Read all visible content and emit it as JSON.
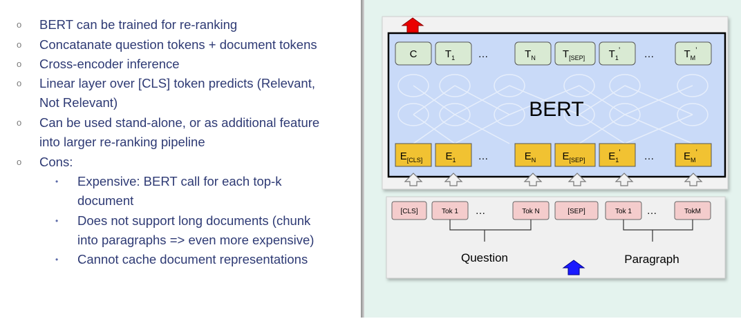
{
  "bullets": {
    "b1": "BERT can be trained for re-ranking",
    "b2": "Concatanate question tokens + document tokens",
    "b3": "Cross-encoder inference",
    "b4_line1": "Linear layer over [CLS] token predicts (Relevant,",
    "b4_line2": "Not Relevant)",
    "b5_line1": "Can be used stand-alone, or as additional feature",
    "b5_line2": "into larger re-ranking pipeline",
    "b6": "Cons:",
    "sub": {
      "s1_line1": "Expensive: BERT call for each top-k",
      "s1_line2": "document",
      "s2_line1": "Does not support long documents (chunk",
      "s2_line2": "into paragraphs => even more expensive)",
      "s3": "Cannot cache document representations"
    }
  },
  "markers": {
    "hollow": "o",
    "dot": "•"
  },
  "diagram": {
    "model_label": "BERT",
    "ellipsis": "…",
    "output_tokens": [
      {
        "base": "C",
        "sub": "",
        "sup": ""
      },
      {
        "base": "T",
        "sub": "1",
        "sup": ""
      },
      {
        "base": "T",
        "sub": "N",
        "sup": ""
      },
      {
        "base": "T",
        "sub": "[SEP]",
        "sup": ""
      },
      {
        "base": "T",
        "sub": "1",
        "sup": "’"
      },
      {
        "base": "T",
        "sub": "M",
        "sup": "’"
      }
    ],
    "embedding_tokens": [
      {
        "base": "E",
        "sub": "[CLS]",
        "sup": ""
      },
      {
        "base": "E",
        "sub": "1",
        "sup": ""
      },
      {
        "base": "E",
        "sub": "N",
        "sup": ""
      },
      {
        "base": "E",
        "sub": "[SEP]",
        "sup": ""
      },
      {
        "base": "E",
        "sub": "1",
        "sup": "’"
      },
      {
        "base": "E",
        "sub": "M",
        "sup": "’"
      }
    ],
    "input_tokens": [
      "[CLS]",
      "Tok 1",
      "Tok N",
      "[SEP]",
      "Tok 1",
      "TokM"
    ],
    "question_label": "Question",
    "paragraph_label": "Paragraph",
    "colors": {
      "output_token_fill": "#d9ead3",
      "embedding_fill": "#f1c232",
      "input_token_fill": "#f4cccc",
      "bert_fill": "#c9daf8",
      "red_arrow": "#ea0000",
      "blue_arrow": "#1a1aff",
      "bullet_text": "#2e3a74",
      "background": "#e4f3ee"
    }
  }
}
